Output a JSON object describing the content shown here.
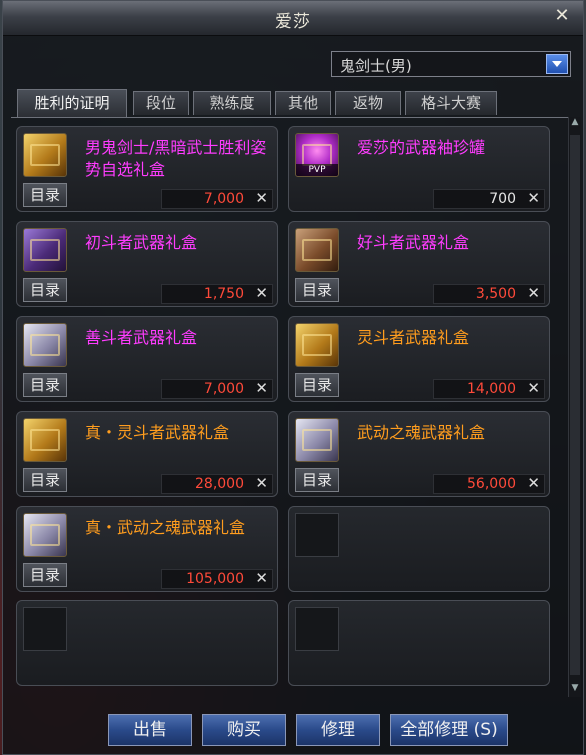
{
  "window": {
    "title": "爱莎",
    "close_icon": "close-icon"
  },
  "class_select": {
    "value": "鬼剑士(男)"
  },
  "tabs": [
    {
      "label": "胜利的证明",
      "active": true
    },
    {
      "label": "段位"
    },
    {
      "label": "熟练度"
    },
    {
      "label": "其他"
    },
    {
      "label": "返物"
    },
    {
      "label": "格斗大赛"
    }
  ],
  "items": [
    {
      "name": "男鬼剑士/黑暗武士胜利姿势自选礼盒",
      "name_color": "#ff3cff",
      "catalog": "目录",
      "price": "7,000",
      "price_color": "red",
      "icon": "gold-box-icon"
    },
    {
      "name": "爱莎的武器袖珍罐",
      "name_color": "#ff3cff",
      "catalog": "",
      "price": "700",
      "price_color": "white",
      "icon": "pvp-jar-icon",
      "badge": "PVP"
    },
    {
      "name": "初斗者武器礼盒",
      "name_color": "#ff3cff",
      "catalog": "目录",
      "price": "1,750",
      "price_color": "red",
      "icon": "purple-box-icon"
    },
    {
      "name": "好斗者武器礼盒",
      "name_color": "#ff3cff",
      "catalog": "目录",
      "price": "3,500",
      "price_color": "red",
      "icon": "brown-box-icon"
    },
    {
      "name": "善斗者武器礼盒",
      "name_color": "#ff3cff",
      "catalog": "目录",
      "price": "7,000",
      "price_color": "red",
      "icon": "silver-box-icon"
    },
    {
      "name": "灵斗者武器礼盒",
      "name_color": "#ff9d1e",
      "catalog": "目录",
      "price": "14,000",
      "price_color": "red",
      "icon": "gold-box-icon"
    },
    {
      "name": "真・灵斗者武器礼盒",
      "name_color": "#ff9d1e",
      "catalog": "目录",
      "price": "28,000",
      "price_color": "red",
      "icon": "gold-box-icon"
    },
    {
      "name": "武动之魂武器礼盒",
      "name_color": "#ff9d1e",
      "catalog": "目录",
      "price": "56,000",
      "price_color": "red",
      "icon": "silver-box-icon"
    },
    {
      "name": "真・武动之魂武器礼盒",
      "name_color": "#ff9d1e",
      "catalog": "目录",
      "price": "105,000",
      "price_color": "red",
      "icon": "silver-box-icon"
    }
  ],
  "buttons": {
    "sell": "出售",
    "buy": "购买",
    "repair": "修理",
    "repair_all": "全部修理 (S)"
  }
}
